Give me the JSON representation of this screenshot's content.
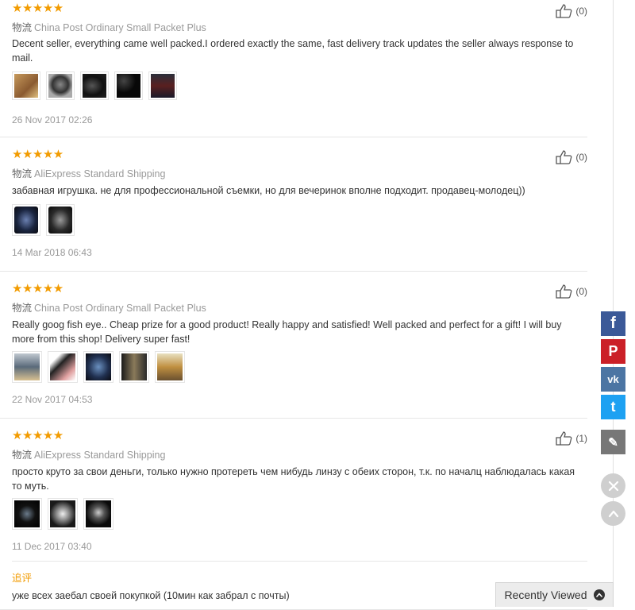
{
  "reviews": [
    {
      "stars": "★★★★★",
      "shipping_cn": "物流",
      "shipping": "China Post Ordinary Small Packet Plus",
      "text": "Decent seller, everything came well packed.I ordered exactly the same, fast delivery track updates the seller always response to mail.",
      "date": "26 Nov 2017 02:26",
      "likes": "(0)",
      "photos": [
        "#b0824e",
        "#5a5a5a",
        "#151515",
        "#0a0a0a",
        "#3a3f4a"
      ]
    },
    {
      "stars": "★★★★★",
      "shipping_cn": "物流",
      "shipping": "AliExpress Standard Shipping",
      "text": "забавная игрушка. не для профессиональной съемки, но для вечеринок вполне подходит. продавец-молодец))",
      "date": "14 Mar 2018 06:43",
      "likes": "(0)",
      "photos": [
        "#2b3a5c",
        "#3a3a3a"
      ]
    },
    {
      "stars": "★★★★★",
      "shipping_cn": "物流",
      "shipping": "China Post Ordinary Small Packet Plus",
      "text": "Really goog fish eye.. Cheap prize for a good product! Really happy and satisfied! Well packed and perfect for a gift! I will buy more from this shop! Delivery super fast!",
      "date": "22 Nov 2017 04:53",
      "likes": "(0)",
      "photos": [
        "#7a8a9a",
        "#2a2a2a",
        "#3c5a8a",
        "#4a4030",
        "#b09050"
      ]
    },
    {
      "stars": "★★★★★",
      "shipping_cn": "物流",
      "shipping": "AliExpress Standard Shipping",
      "text": "просто круто за свои деньги, только нужно протереть чем нибудь линзу с обеих сторон, т.к. по началц наблюдалась какая то муть.",
      "date": "11 Dec 2017 03:40",
      "likes": "(1)",
      "photos": [
        "#151515",
        "#888888",
        "#2a2a2a"
      ]
    }
  ],
  "followup": {
    "label": "追评",
    "text": "уже всех заебал своей покупкой (10мин как забрал с почты)"
  },
  "share": [
    {
      "name": "facebook",
      "glyph": "f",
      "color": "#3b5998"
    },
    {
      "name": "pinterest",
      "glyph": "P",
      "color": "#cb2027"
    },
    {
      "name": "vk",
      "glyph": "vk",
      "color": "#4c75a3"
    },
    {
      "name": "twitter",
      "glyph": "t",
      "color": "#1da1f2"
    },
    {
      "name": "edit",
      "glyph": "✎",
      "color": "#777777"
    }
  ],
  "recently_viewed": "Recently Viewed"
}
